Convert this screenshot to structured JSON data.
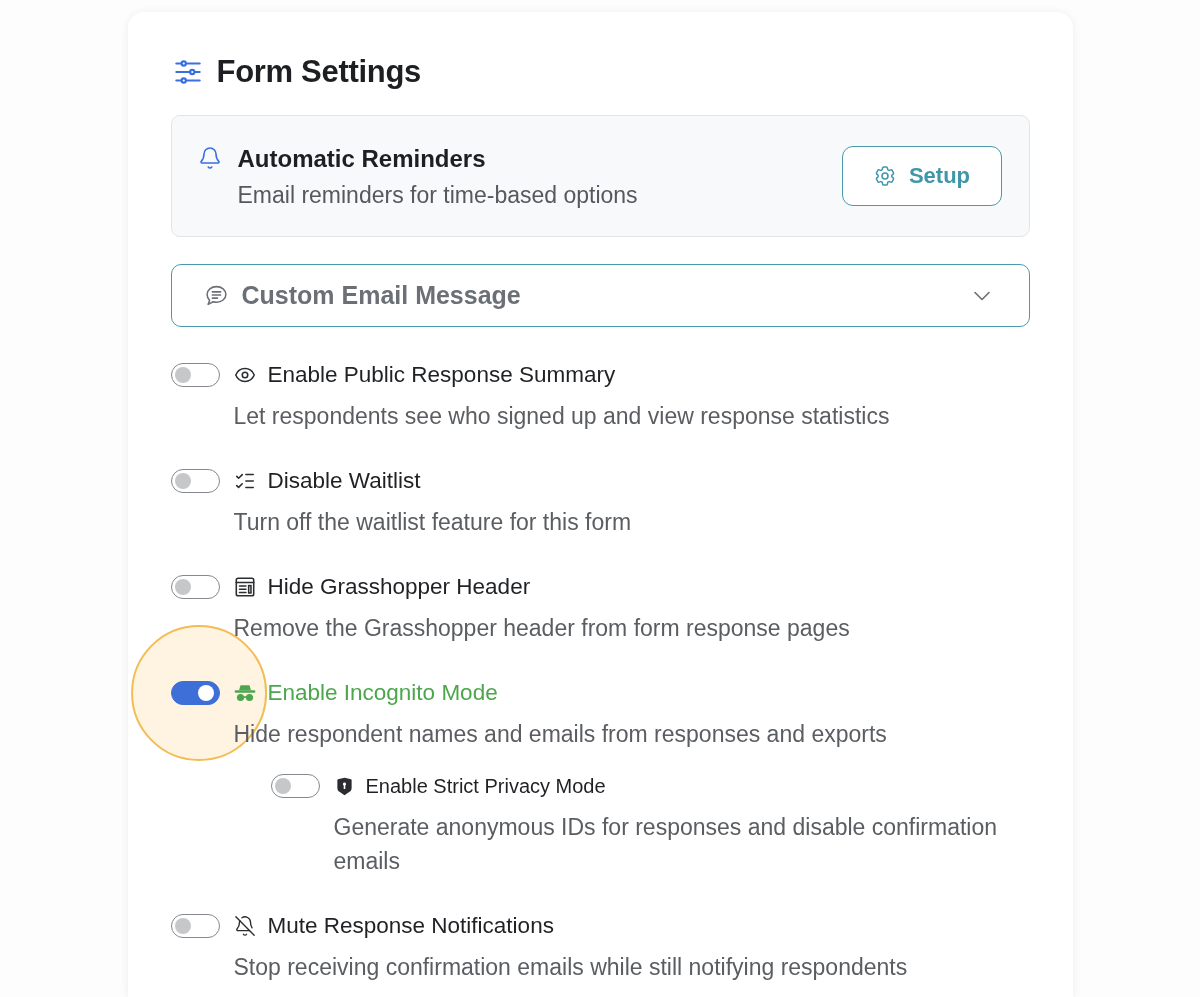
{
  "page_title": {
    "text": "Form Settings"
  },
  "reminder_card": {
    "title": "Automatic Reminders",
    "subtitle": "Email reminders for time-based options",
    "button": "Setup"
  },
  "email_dropdown": {
    "label": "Custom Email Message",
    "expanded": false
  },
  "settings": [
    {
      "label": "Enable Public Response Summary",
      "description": "Let respondents see who signed up and view response statistics",
      "on": false,
      "highlighted": false
    },
    {
      "label": "Disable Waitlist",
      "description": "Turn off the waitlist feature for this form",
      "on": false,
      "highlighted": false
    },
    {
      "label": "Hide Grasshopper Header",
      "description": "Remove the Grasshopper header from form response pages",
      "on": false,
      "highlighted": false
    },
    {
      "label": "Enable Incognito Mode",
      "description": "Hide respondent names and emails from responses and exports",
      "on": true,
      "highlighted": true,
      "children": [
        {
          "label": "Enable Strict Privacy Mode",
          "description": "Generate anonymous IDs for responses and disable confirmation emails",
          "on": false,
          "highlighted": false
        }
      ]
    },
    {
      "label": "Mute Response Notifications",
      "description": "Stop receiving confirmation emails while still notifying respondents",
      "on": false,
      "highlighted": false
    }
  ]
}
